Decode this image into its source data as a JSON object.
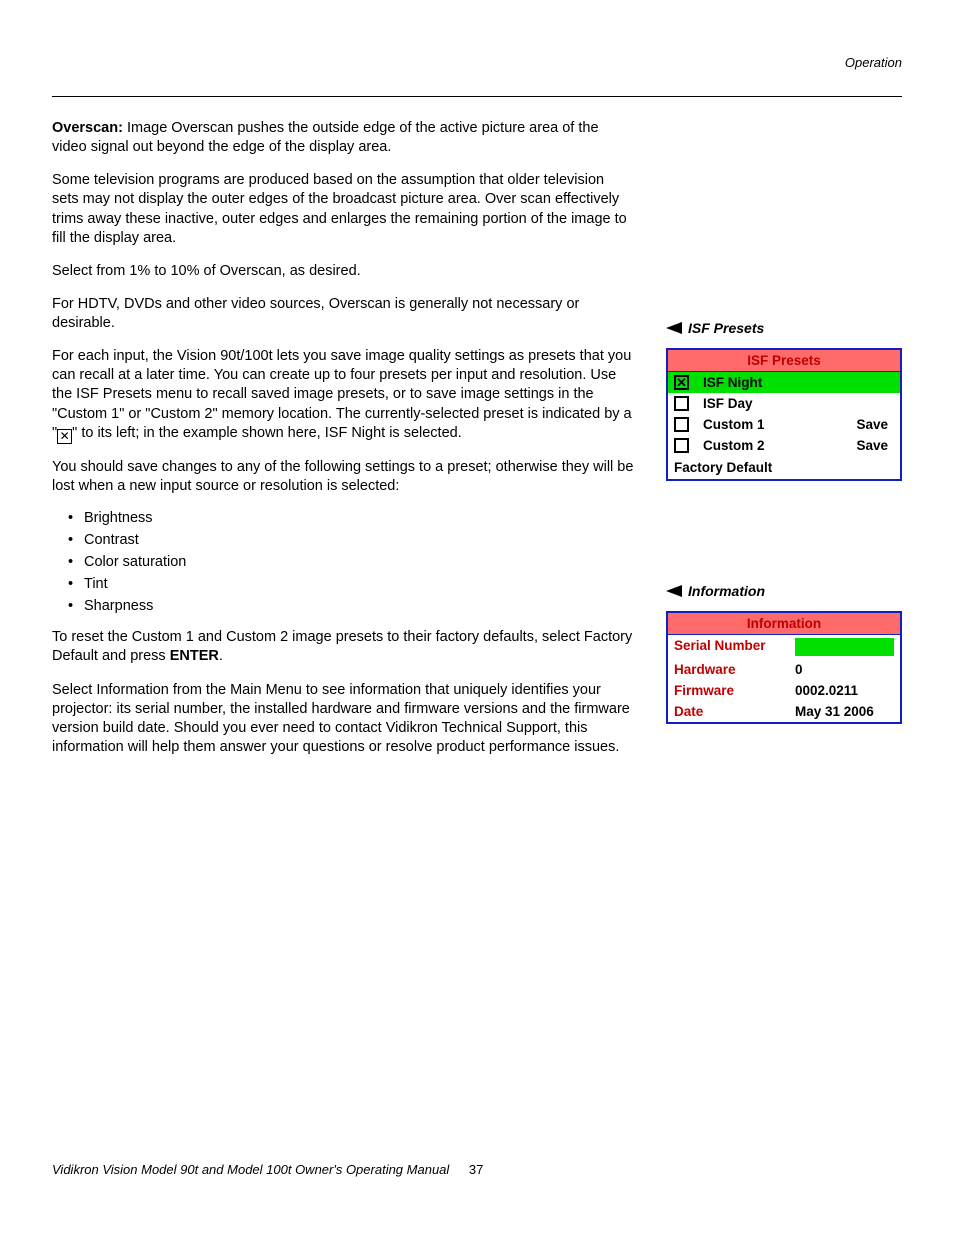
{
  "header": {
    "section": "Operation"
  },
  "body": {
    "overscan_label": "Overscan:",
    "p1_rest": " Image Overscan pushes the outside edge of the active picture area of the video signal out beyond the edge of the display area.",
    "p2": "Some television programs are produced based on the assumption that older television sets may not display the outer edges of the broadcast picture area. Over scan effectively trims away these inactive, outer edges and enlarges the remaining portion of the image to fill the display area.",
    "p3": "Select from 1% to 10% of Overscan, as desired.",
    "p4": "For HDTV, DVDs and other video sources, Overscan is generally not necessary or desirable.",
    "p5": "For each input, the Vision 90t/100t lets you save image quality settings as presets that you can recall at a later time. You can create up to four presets per input and resolution. Use the ISF Presets menu to recall saved image presets, or to save image settings in the \"Custom 1\" or \"Custom 2\" memory location. The currently-selected preset is indicated by a \"",
    "p5b": "\" to its left; in the example shown here, ISF Night is selected.",
    "p6": "You should save changes to any of the following settings to a preset; otherwise they will be lost when a new input source or resolution is selected:",
    "bullets": [
      "Brightness",
      "Contrast",
      "Color saturation",
      "Tint",
      "Sharpness"
    ],
    "p7a": "To reset the Custom 1 and Custom 2 image presets to their factory defaults, select Factory Default and press ",
    "p7b": "ENTER",
    "p7c": ".",
    "p8": "Select Information from the Main Menu to see information that uniquely identifies your projector: its serial number, the installed hardware and firmware versions and the firmware version build date. Should you ever need to contact Vidikron Technical Support, this information will help them answer your questions or resolve product performance issues."
  },
  "side": {
    "isf_label": "ISF Presets",
    "info_label": "Information"
  },
  "isf_menu": {
    "title": "ISF Presets",
    "rows": [
      {
        "checked": true,
        "label": "ISF Night",
        "action": "",
        "selected": true
      },
      {
        "checked": false,
        "label": "ISF Day",
        "action": "",
        "selected": false
      },
      {
        "checked": false,
        "label": "Custom 1",
        "action": "Save",
        "selected": false
      },
      {
        "checked": false,
        "label": "Custom 2",
        "action": "Save",
        "selected": false
      }
    ],
    "footer": "Factory Default"
  },
  "info_menu": {
    "title": "Information",
    "rows": [
      {
        "key": "Serial Number",
        "val": ""
      },
      {
        "key": "Hardware",
        "val": "0"
      },
      {
        "key": "Firmware",
        "val": "0002.0211"
      },
      {
        "key": "Date",
        "val": "May 31 2006"
      }
    ]
  },
  "footer": {
    "text": "Vidikron Vision Model 90t and Model 100t Owner's Operating Manual",
    "page": "37"
  }
}
